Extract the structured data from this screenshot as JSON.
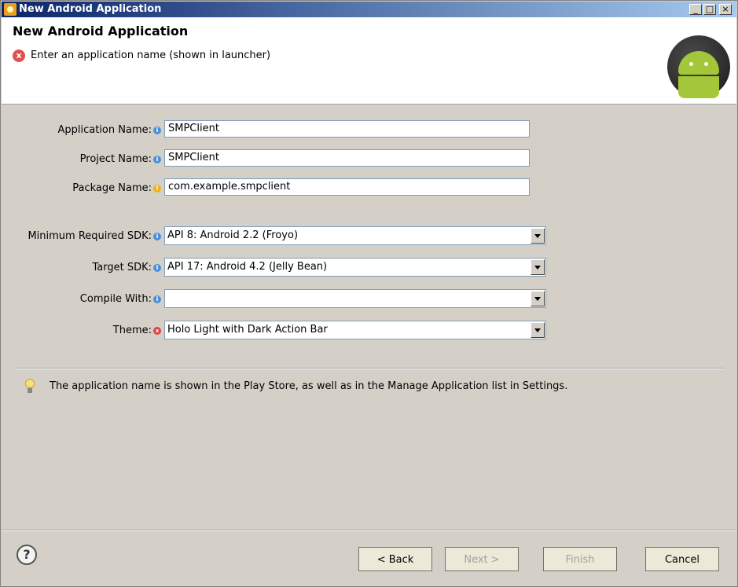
{
  "window": {
    "title": "New Android Application"
  },
  "titlebar_buttons": {
    "minimize": "_",
    "maximize": "□",
    "close": "×"
  },
  "header": {
    "title": "New Android Application",
    "error_message": "Enter an application name (shown in launcher)"
  },
  "form": {
    "application_name": {
      "label": "Application Name:",
      "value": "SMPClient"
    },
    "project_name": {
      "label": "Project Name:",
      "value": "SMPClient"
    },
    "package_name": {
      "label": "Package Name:",
      "value": "com.example.smpclient"
    },
    "min_sdk": {
      "label": "Minimum Required SDK:",
      "value": "API 8: Android 2.2 (Froyo)"
    },
    "target_sdk": {
      "label": "Target SDK:",
      "value": "API 17: Android 4.2 (Jelly Bean)"
    },
    "compile_with": {
      "label": "Compile With:",
      "value": ""
    },
    "theme": {
      "label": "Theme:",
      "value": "Holo Light with Dark Action Bar"
    }
  },
  "hint": "The application name is shown in the Play Store, as well as in the Manage Application list in Settings.",
  "buttons": {
    "help": "?",
    "back": "< Back",
    "next": "Next >",
    "finish": "Finish",
    "cancel": "Cancel"
  },
  "colors": {
    "titlebar_start": "#0a246a",
    "titlebar_end": "#a6caf0",
    "android_green": "#a4c639",
    "error_red": "#e05050",
    "info_blue": "#4a8fd8",
    "warning_yellow": "#f0b020"
  }
}
